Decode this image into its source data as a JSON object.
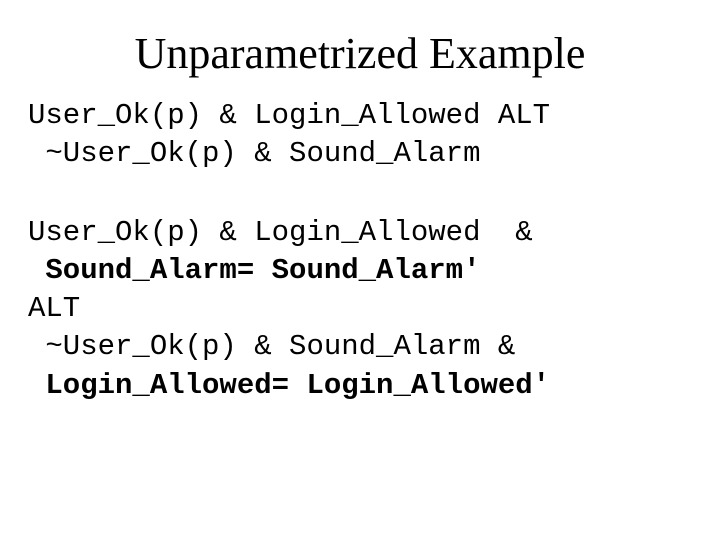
{
  "title": "Unparametrized Example",
  "block1": {
    "line1": "User_Ok(p) & Login_Allowed ALT",
    "line2": " ~User_Ok(p) & Sound_Alarm"
  },
  "block2": {
    "line1": "User_Ok(p) & Login_Allowed  &",
    "line2a": " ",
    "line2b": "Sound_Alarm= Sound_Alarm'",
    "line3": "ALT",
    "line4": " ~User_Ok(p) & Sound_Alarm &",
    "line5a": " ",
    "line5b": "Login_Allowed= Login_Allowed'"
  }
}
